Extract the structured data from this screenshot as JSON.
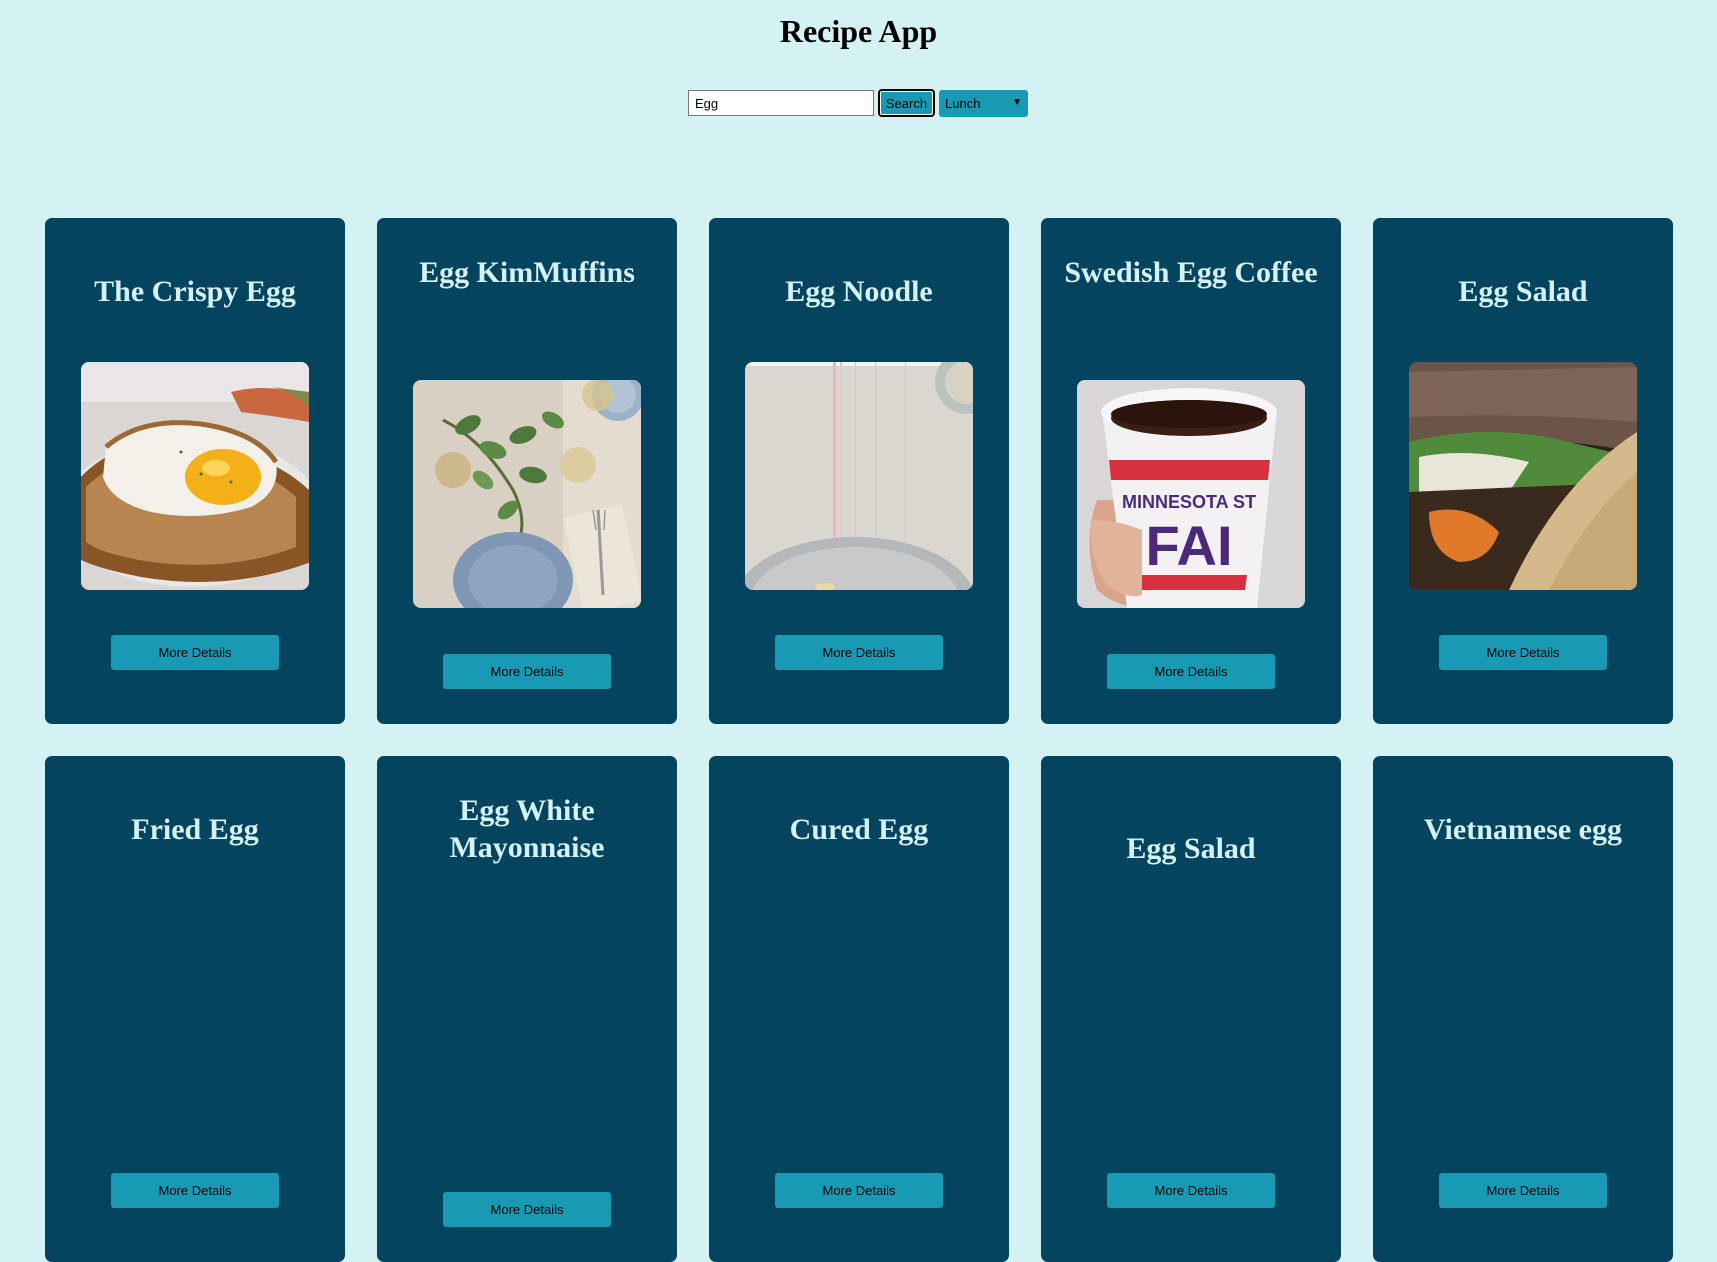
{
  "app": {
    "title": "Recipe App"
  },
  "search": {
    "value": "Egg",
    "button_label": "Search",
    "meal_type": "Lunch"
  },
  "recipes": [
    {
      "title": "The Crispy Egg",
      "button_label": "More Details",
      "image": "fried-egg-toast"
    },
    {
      "title": "Egg KimMuffins",
      "button_label": "More Details",
      "image": "table-setting"
    },
    {
      "title": "Egg Noodle",
      "button_label": "More Details",
      "image": "linen-plate"
    },
    {
      "title": "Swedish Egg Coffee",
      "button_label": "More Details",
      "image": "coffee-cup"
    },
    {
      "title": "Egg Salad",
      "button_label": "More Details",
      "image": "sandwich"
    },
    {
      "title": "Fried Egg",
      "button_label": "More Details"
    },
    {
      "title": "Egg White Mayonnaise",
      "button_label": "More Details"
    },
    {
      "title": "Cured Egg",
      "button_label": "More Details"
    },
    {
      "title": "Egg Salad",
      "button_label": "More Details"
    },
    {
      "title": "Vietnamese egg",
      "button_label": "More Details"
    }
  ]
}
